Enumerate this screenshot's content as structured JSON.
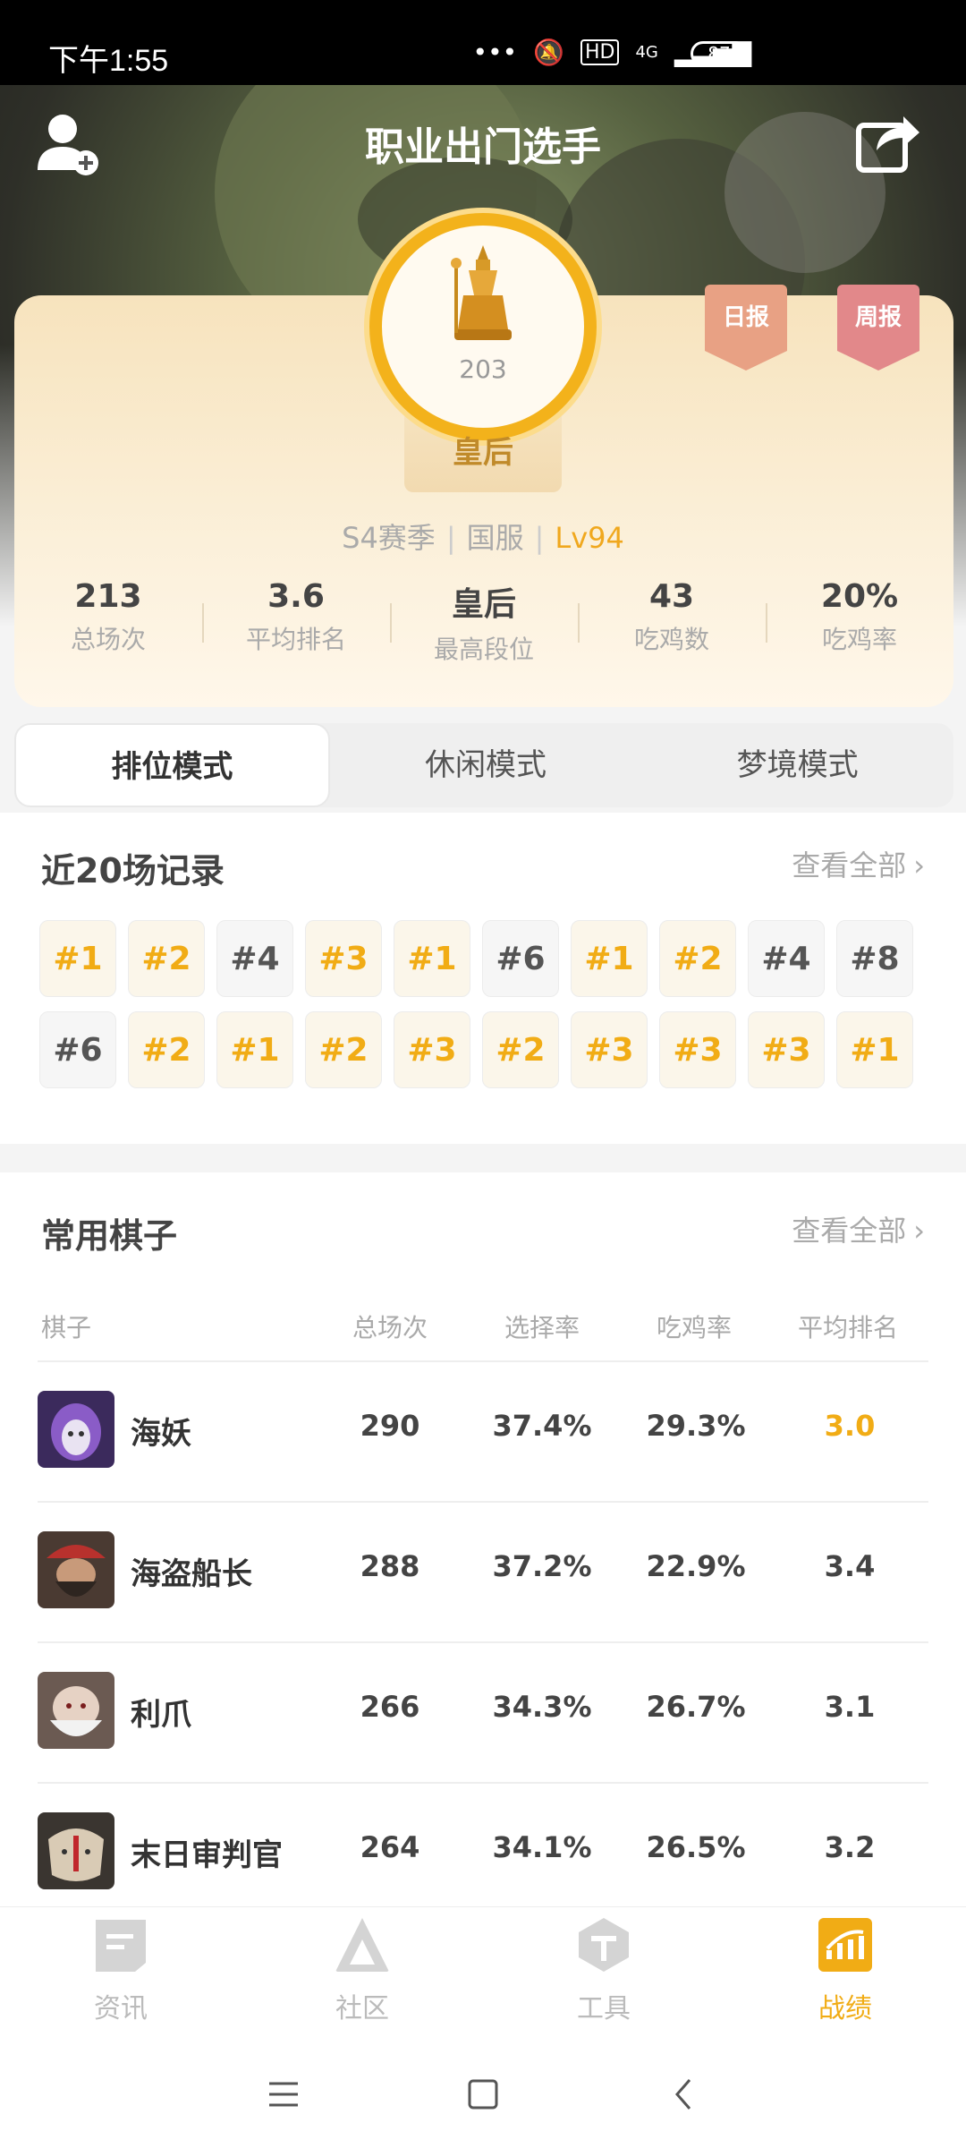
{
  "status_bar": {
    "time": "下午1:55",
    "network": "4G",
    "battery": "87"
  },
  "header": {
    "title": "职业出门选手"
  },
  "profile": {
    "rank_points": "203",
    "rank_name": "皇后",
    "season": "S4赛季",
    "server": "国服",
    "level": "Lv94",
    "ribbons": {
      "daily": "日报",
      "weekly": "周报"
    }
  },
  "stats": [
    {
      "value": "213",
      "label": "总场次"
    },
    {
      "value": "3.6",
      "label": "平均排名"
    },
    {
      "value": "皇后",
      "label": "最高段位"
    },
    {
      "value": "43",
      "label": "吃鸡数"
    },
    {
      "value": "20%",
      "label": "吃鸡率"
    }
  ],
  "tabs": [
    {
      "label": "排位模式",
      "active": true
    },
    {
      "label": "休闲模式",
      "active": false
    },
    {
      "label": "梦境模式",
      "active": false
    }
  ],
  "recent": {
    "title": "近20场记录",
    "see_all": "查看全部",
    "records": [
      "#1",
      "#2",
      "#4",
      "#3",
      "#1",
      "#6",
      "#1",
      "#2",
      "#4",
      "#8",
      "#6",
      "#2",
      "#1",
      "#2",
      "#3",
      "#2",
      "#3",
      "#3",
      "#3",
      "#1"
    ]
  },
  "heroes": {
    "title": "常用棋子",
    "see_all": "查看全部",
    "columns": [
      "棋子",
      "总场次",
      "选择率",
      "吃鸡率",
      "平均排名"
    ],
    "rows": [
      {
        "name": "海妖",
        "games": "290",
        "pick": "37.4%",
        "win": "29.3%",
        "avg": "3.0",
        "highlight": true
      },
      {
        "name": "海盗船长",
        "games": "288",
        "pick": "37.2%",
        "win": "22.9%",
        "avg": "3.4",
        "highlight": false
      },
      {
        "name": "利爪",
        "games": "266",
        "pick": "34.3%",
        "win": "26.7%",
        "avg": "3.1",
        "highlight": false
      },
      {
        "name": "末日审判官",
        "games": "264",
        "pick": "34.1%",
        "win": "26.5%",
        "avg": "3.2",
        "highlight": false
      }
    ]
  },
  "bottom_nav": [
    {
      "label": "资讯",
      "icon": "news-icon",
      "active": false
    },
    {
      "label": "社区",
      "icon": "community-icon",
      "active": false
    },
    {
      "label": "工具",
      "icon": "tools-icon",
      "active": false
    },
    {
      "label": "战绩",
      "icon": "stats-icon",
      "active": true
    }
  ],
  "colors": {
    "accent": "#f1ac15",
    "tab_bg": "#efefef",
    "ribbon_daily": "#e8a184",
    "ribbon_weekly": "#e2888a"
  }
}
